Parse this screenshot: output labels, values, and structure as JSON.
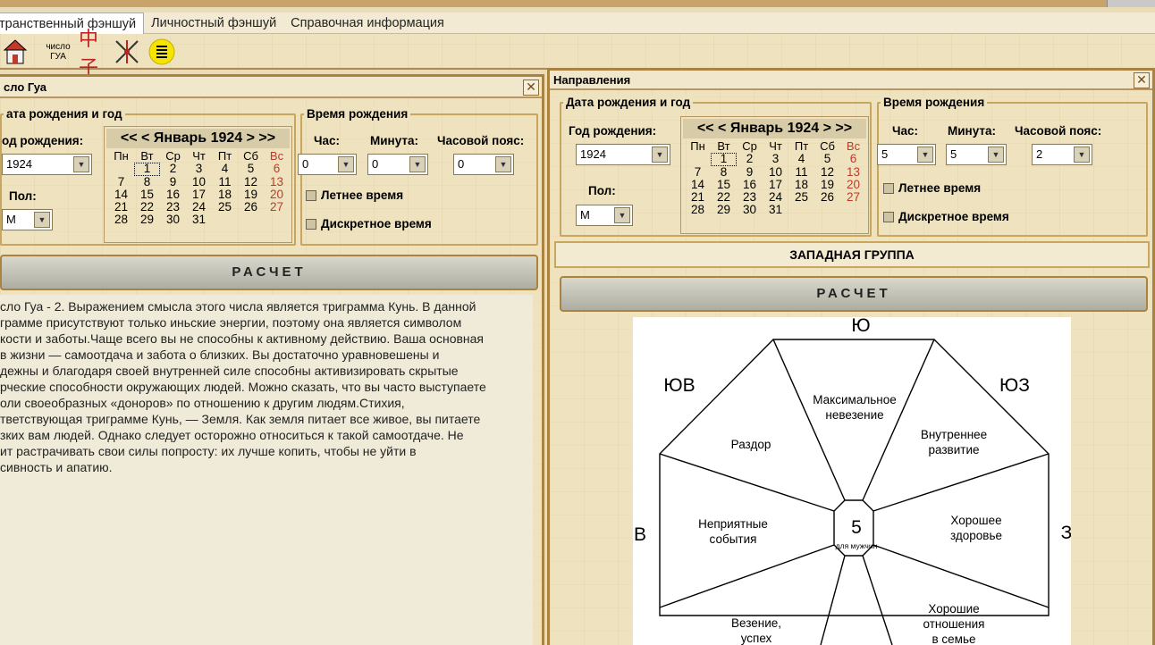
{
  "menu": [
    "транственный фэншуй",
    "Личностный фэншуй",
    "Справочная информация"
  ],
  "toolbar": {
    "gua_line1": "число",
    "gua_line2": "ГУА",
    "hanzi": "中子"
  },
  "left": {
    "title": "сло Гуа",
    "close": "✕",
    "date_group": "ата рождения и год",
    "year_label": "од рождения:",
    "year_value": "1924",
    "sex_label": "Пол:",
    "sex_value": "М",
    "time_group": "Время рождения",
    "hour_label": "Час:",
    "min_label": "Минута:",
    "tz_label": "Часовой пояс:",
    "hour_value": "0",
    "min_value": "0",
    "tz_value": "0",
    "summer": "Летнее время",
    "discrete": "Дискретное время",
    "calc": "РАСЧЕТ",
    "description": "сло Гуа - 2. Выражением смысла этого числа является триграмма Кунь. В данной\nграмме присутствуют только иньские энергии, поэтому она является символом\nкости и заботы.Чаще всего вы не способны к активному действию. Ваша основная\nв жизни — самоотдача и забота о близких. Вы достаточно уравновешены и\nдежны и благодаря своей внутренней силе способны активизировать скрытые\nрческие способности окружающих людей. Можно сказать, что вы часто выступаете\nоли своеобразных «доноров» по отношению к другим людям.Стихия,\nтветствующая триграмме Кунь, — Земля. Как земля питает все живое, вы питаете\nзких вам людей. Однако следует осторожно относиться к такой самоотдаче. Не\nит растрачивать свои силы попросту: их лучше копить, чтобы не уйти в\nсивность и апатию."
  },
  "right": {
    "title": "Направления",
    "close": "✕",
    "date_group": "Дата рождения и год",
    "year_label": "Год рождения:",
    "year_value": "1924",
    "sex_label": "Пол:",
    "sex_value": "М",
    "time_group": "Время рождения",
    "hour_label": "Час:",
    "min_label": "Минута:",
    "tz_label": "Часовой пояс:",
    "hour_value": "5",
    "min_value": "5",
    "tz_value": "2",
    "summer": "Летнее время",
    "discrete": "Дискретное время",
    "group": "ЗАПАДНАЯ ГРУППА",
    "calc": "РАСЧЕТ"
  },
  "calendar": {
    "nav": "<< < Январь 1924 > >>",
    "weekdays": [
      "Пн",
      "Вт",
      "Ср",
      "Чт",
      "Пт",
      "Сб",
      "Вс"
    ],
    "days": [
      "",
      "1",
      "2",
      "3",
      "4",
      "5",
      "6",
      "7",
      "8",
      "9",
      "10",
      "11",
      "12",
      "13",
      "14",
      "15",
      "16",
      "17",
      "18",
      "19",
      "20",
      "21",
      "22",
      "23",
      "24",
      "25",
      "26",
      "27",
      "28",
      "29",
      "30",
      "31",
      "",
      "",
      ""
    ],
    "today": "1"
  },
  "bagua": {
    "directions": {
      "top": "Ю",
      "top_left": "ЮВ",
      "top_right": "ЮЗ",
      "left": "В",
      "right": "З"
    },
    "center_number": "5",
    "center_note": "для мужчин",
    "sectors": {
      "top": [
        "Максимальное",
        "невезение"
      ],
      "upper_left": [
        "Раздор"
      ],
      "upper_right": [
        "Внутреннее",
        "развитие"
      ],
      "left": [
        "Неприятные",
        "события"
      ],
      "right": [
        "Хорошее",
        "здоровье"
      ],
      "lower_left": [
        "Везение,",
        "успех"
      ],
      "lower_right": [
        "Хорошие",
        "отношения",
        "в семье"
      ]
    }
  }
}
